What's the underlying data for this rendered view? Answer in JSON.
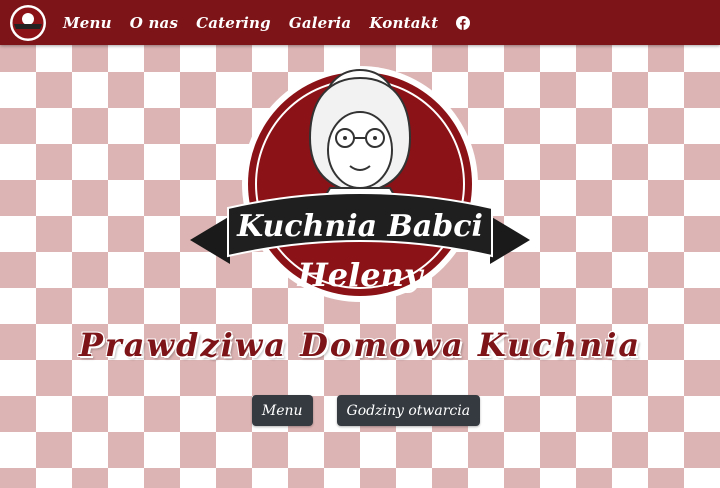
{
  "nav": {
    "logo_text": "Kuchnia Babci Heleny",
    "links": [
      "Menu",
      "O nas",
      "Catering",
      "Galeria",
      "Kontakt"
    ],
    "social_icon": "facebook-icon"
  },
  "hero": {
    "logo_line1": "Kuchnia Babci",
    "logo_line2": "Heleny",
    "tagline": "Prawdziwa Domowa Kuchnia",
    "buttons": {
      "menu": "Menu",
      "hours": "Godziny otwarcia"
    }
  },
  "colors": {
    "brand": "#7d1418",
    "checker": "#dcb4b4",
    "button": "#343a40"
  }
}
